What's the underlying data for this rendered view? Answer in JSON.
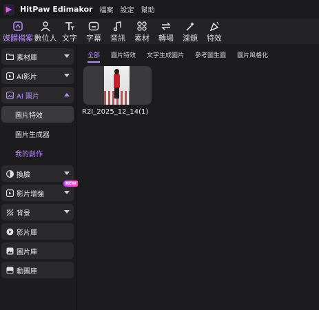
{
  "app": {
    "title": "HitPaw Edimakor",
    "menu": [
      "檔案",
      "設定",
      "幫助"
    ]
  },
  "toolbar": {
    "items": [
      {
        "label": "媒體檔案",
        "icon": "media-icon",
        "active": true
      },
      {
        "label": "數位人",
        "icon": "avatar-icon"
      },
      {
        "label": "文字",
        "icon": "text-icon"
      },
      {
        "label": "字幕",
        "icon": "subtitle-icon"
      },
      {
        "label": "音訊",
        "icon": "audio-icon"
      },
      {
        "label": "素材",
        "icon": "assets-icon"
      },
      {
        "label": "轉場",
        "icon": "transition-icon"
      },
      {
        "label": "濾鏡",
        "icon": "filter-icon"
      },
      {
        "label": "特效",
        "icon": "effects-icon"
      }
    ]
  },
  "sidebar": {
    "items": [
      {
        "label": "素材庫",
        "icon": "folder-icon"
      },
      {
        "label": "AI影片",
        "icon": "ai-video-icon"
      },
      {
        "label": "AI 圖片",
        "icon": "ai-image-icon"
      },
      {
        "label": "圖片特效"
      },
      {
        "label": "圖片生成器"
      },
      {
        "label": "我的創作"
      },
      {
        "label": "換臉",
        "icon": "face-swap-icon"
      },
      {
        "label": "影片增強",
        "icon": "enhance-icon",
        "badge": "NEW"
      },
      {
        "label": "背景",
        "icon": "background-icon"
      },
      {
        "label": "影片庫",
        "icon": "video-library-icon"
      },
      {
        "label": "圖片庫",
        "icon": "image-library-icon"
      },
      {
        "label": "動圖庫",
        "icon": "gif-icon"
      }
    ]
  },
  "main": {
    "tabs": [
      "全部",
      "圖片特效",
      "文字生成圖片",
      "參考圖生圖",
      "圖片風格化"
    ],
    "files": [
      {
        "name": "R2I_2025_12_14(1)"
      }
    ]
  },
  "colors": {
    "accent": "#b58cff",
    "background": "#1c1c1f",
    "panel": "#2a2a2d"
  }
}
